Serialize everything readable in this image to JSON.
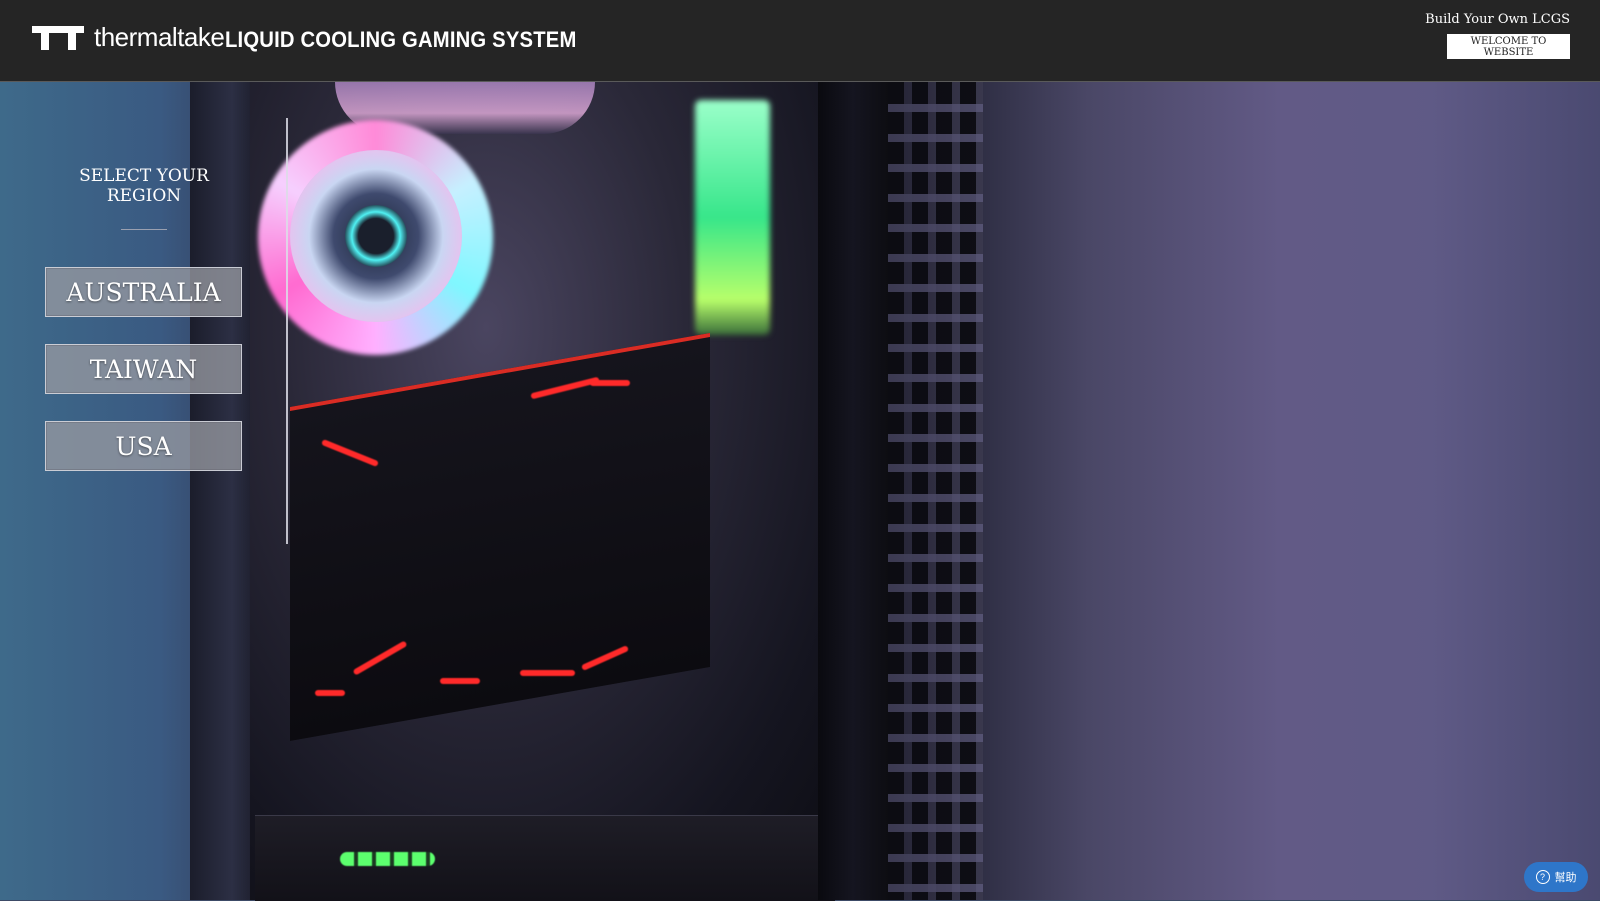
{
  "header": {
    "brand": "thermaltake",
    "title": "LIQUID COOLING GAMING SYSTEM",
    "build_text": "Build Your Own LCGS",
    "welcome_button": "WELCOME TO WEBSITE"
  },
  "region": {
    "heading": "SELECT YOUR REGION",
    "options": [
      "AUSTRALIA",
      "TAIWAN",
      "USA"
    ]
  },
  "help": {
    "icon": "?",
    "label": "幫助"
  },
  "colors": {
    "header_bg": "#252525",
    "help_button": "#2e76c9",
    "region_button": "#96989f"
  },
  "icons": {
    "logo": "thermaltake-logo-icon",
    "help": "question-circle-icon"
  }
}
